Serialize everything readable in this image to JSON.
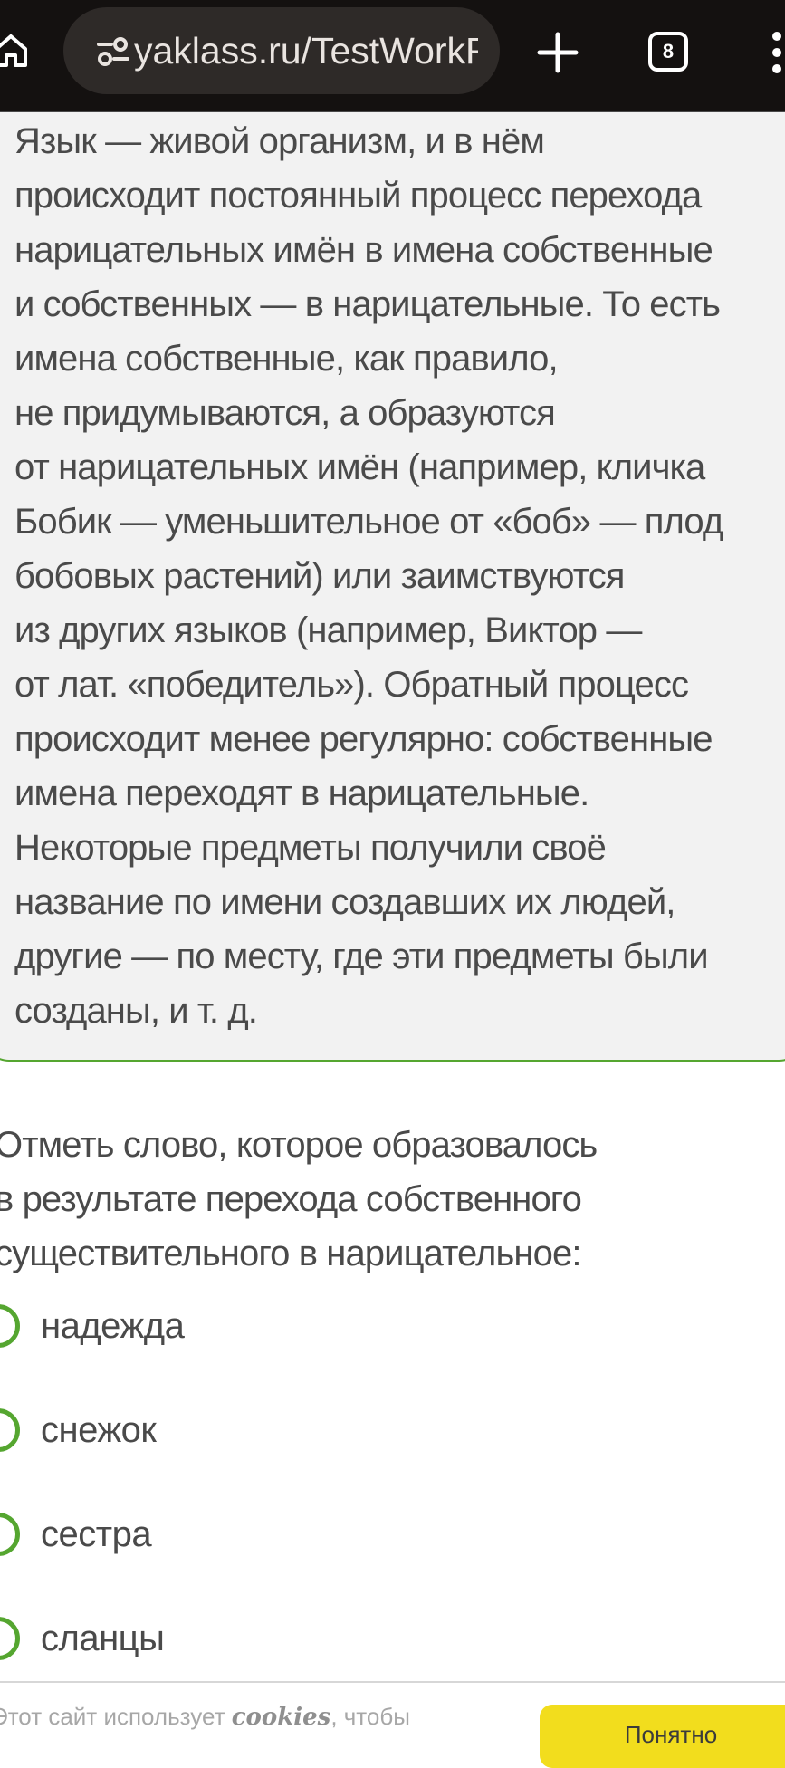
{
  "browser": {
    "url": "yaklass.ru/TestWorkRu",
    "tab_count": "8",
    "icons": {
      "home": "home-icon",
      "site_info": "tune-icon",
      "new_tab": "plus-icon",
      "tabs": "tab-switcher-icon",
      "menu": "more-vert-icon"
    }
  },
  "theory": {
    "lines": [
      "Язык — живой организм, и в нём",
      "происходит постоянный процесс перехода",
      "нарицательных имён в имена собственные",
      "и собственных — в нарицательные. То есть",
      "имена собственные, как правило,",
      "не придумываются, а образуются",
      "от нарицательных имён (например, кличка",
      "Бобик — уменьшительное от «боб» — плод",
      "бобовых растений) или заимствуются",
      "из других языков (например, Виктор —",
      "от лат. «победитель»). Обратный процесс",
      "происходит менее регулярно: собственные",
      "имена переходят в нарицательные.",
      "Некоторые предметы получили своё",
      "название по имени создавших их людей,",
      "другие — по месту, где эти предметы были",
      "созданы, и т. д."
    ]
  },
  "question": {
    "lines": [
      "Отметь слово, которое образовалось",
      "в результате перехода собственного",
      "существительного в нарицательное:"
    ]
  },
  "options": [
    "надежда",
    "снежок",
    "сестра",
    "сланцы"
  ],
  "cookie": {
    "prefix": "Этот сайт использует ",
    "keyword": "cookies",
    "suffix": ", чтобы",
    "button": "Понятно"
  },
  "colors": {
    "accent_green": "#55a630",
    "button_yellow": "#f2dd1d",
    "toolbar_bg": "#141110",
    "panel_bg": "#f2f2f2"
  }
}
